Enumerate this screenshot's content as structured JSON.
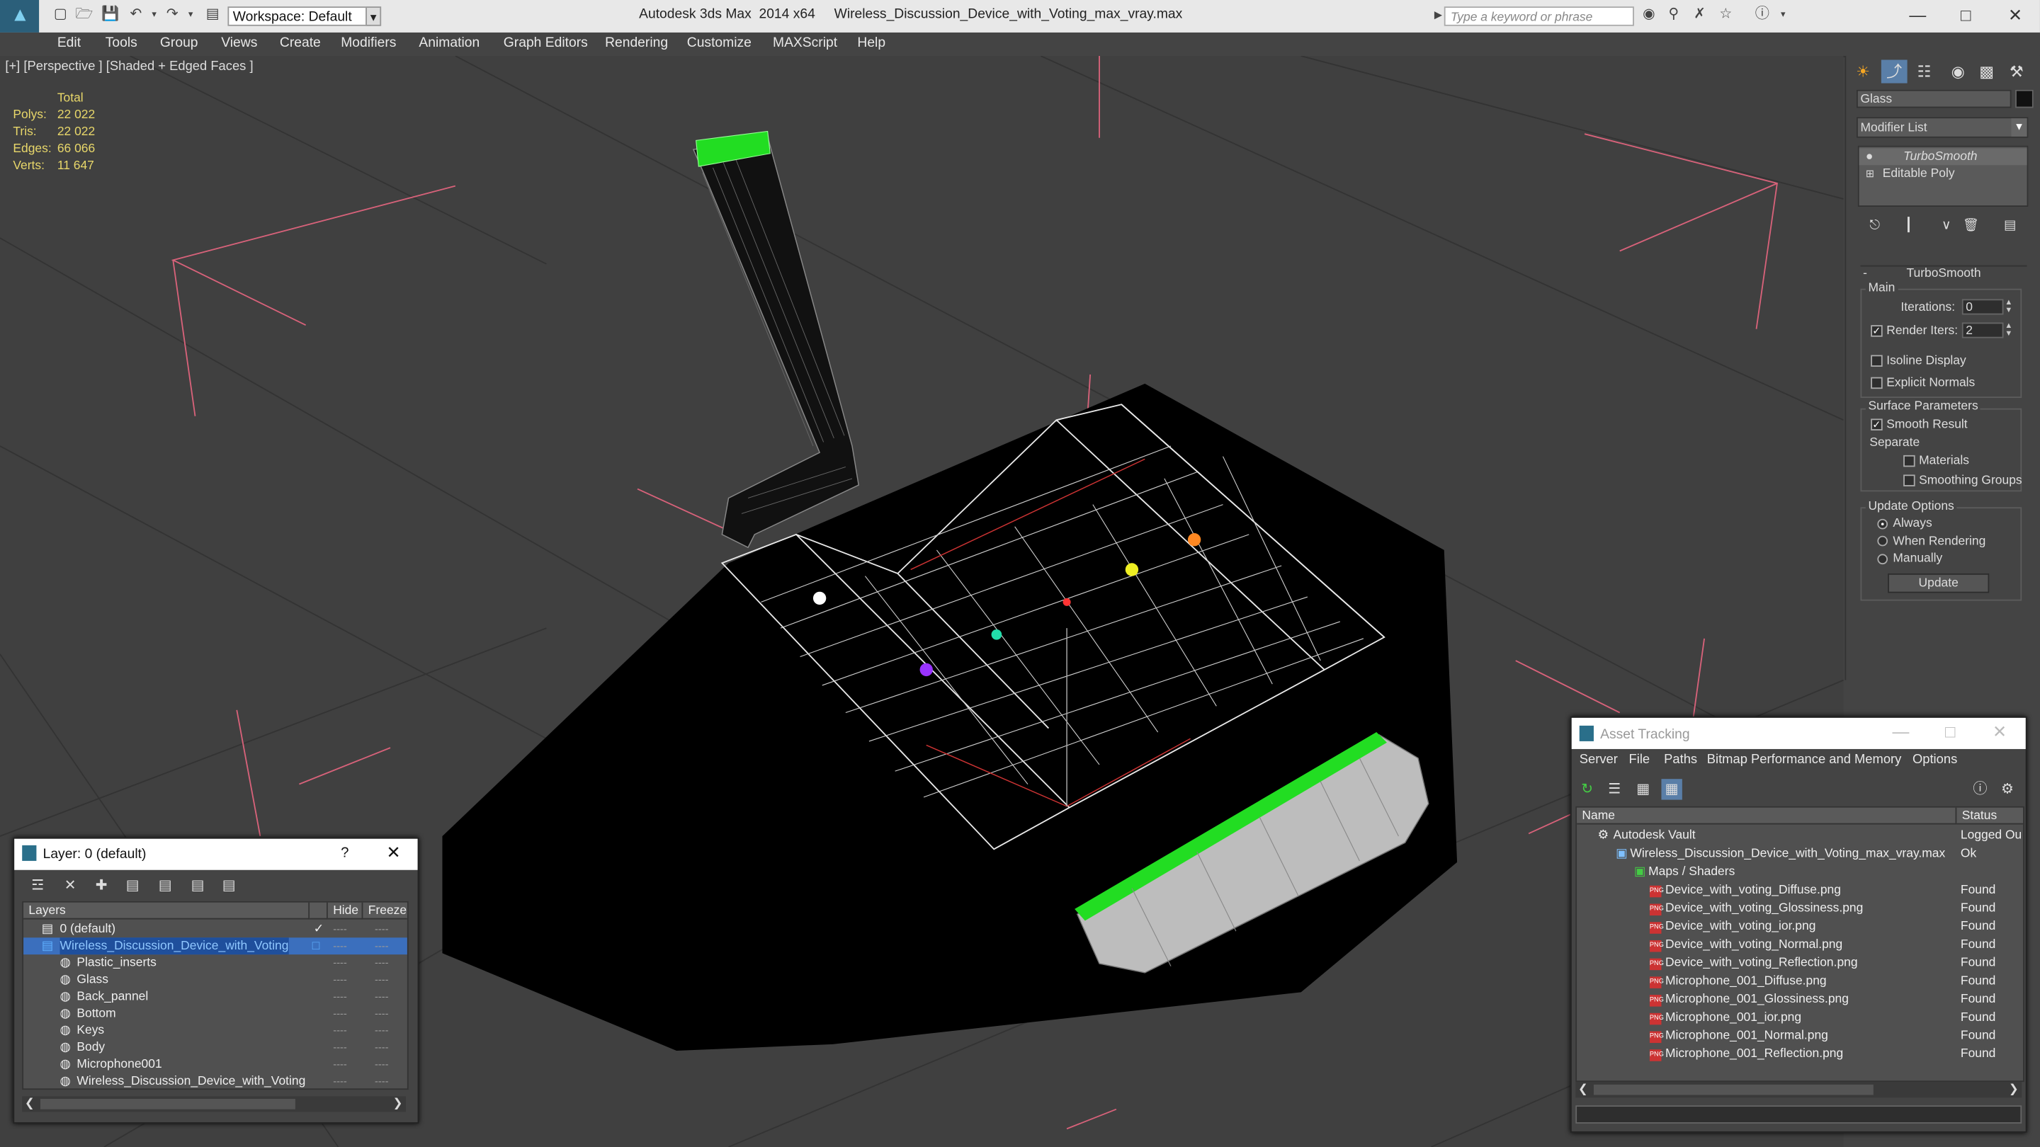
{
  "title_bar": {
    "workspace": "Workspace: Default",
    "app_title": "Autodesk 3ds Max  2014 x64",
    "file_name": "Wireless_Discussion_Device_with_Voting_max_vray.max",
    "search_placeholder": "Type a keyword or phrase"
  },
  "menu": [
    "Edit",
    "Tools",
    "Group",
    "Views",
    "Create",
    "Modifiers",
    "Animation",
    "Graph Editors",
    "Rendering",
    "Customize",
    "MAXScript",
    "Help"
  ],
  "viewport": {
    "label": "[+] [Perspective ] [Shaded + Edged Faces ]",
    "stats": {
      "total_label": "Total",
      "rows": [
        {
          "label": "Polys:",
          "value": "22 022"
        },
        {
          "label": "Tris:",
          "value": "22 022"
        },
        {
          "label": "Edges:",
          "value": "66 066"
        },
        {
          "label": "Verts:",
          "value": "11 647"
        }
      ]
    }
  },
  "command_panel": {
    "object_name": "Glass",
    "modifier_list": "Modifier List",
    "stack": [
      "TurboSmooth",
      "Editable Poly"
    ],
    "rollout_title": "TurboSmooth",
    "main_label": "Main",
    "iterations_label": "Iterations:",
    "iterations_value": "0",
    "render_iters_label": "Render Iters:",
    "render_iters_value": "2",
    "isoline_display": "Isoline Display",
    "explicit_normals": "Explicit Normals",
    "surface_params": "Surface Parameters",
    "smooth_result": "Smooth Result",
    "separate": "Separate",
    "materials": "Materials",
    "smoothing_groups": "Smoothing Groups",
    "update_options": "Update Options",
    "always": "Always",
    "when_rendering": "When Rendering",
    "manually": "Manually",
    "update_button": "Update"
  },
  "layer_dialog": {
    "title": "Layer: 0 (default)",
    "help": "?",
    "col_layers": "Layers",
    "col_hide": "Hide",
    "col_freeze": "Freeze",
    "dash": "----",
    "layers": [
      {
        "name": "0 (default)"
      },
      {
        "name": "Wireless_Discussion_Device_with_Voting"
      },
      {
        "name": "Plastic_inserts"
      },
      {
        "name": "Glass"
      },
      {
        "name": "Back_pannel"
      },
      {
        "name": "Bottom"
      },
      {
        "name": "Keys"
      },
      {
        "name": "Body"
      },
      {
        "name": "Microphone001"
      },
      {
        "name": "Wireless_Discussion_Device_with_Voting"
      }
    ]
  },
  "asset_tracking": {
    "title": "Asset Tracking",
    "menu": [
      "Server",
      "File",
      "Paths",
      "Bitmap Performance and Memory",
      "Options"
    ],
    "col_name": "Name",
    "col_status": "Status",
    "rows": [
      {
        "name": "Autodesk Vault",
        "status": "Logged Ou"
      },
      {
        "name": "Wireless_Discussion_Device_with_Voting_max_vray.max",
        "status": "Ok"
      },
      {
        "name": "Maps / Shaders",
        "status": ""
      },
      {
        "name": "Device_with_voting_Diffuse.png",
        "status": "Found"
      },
      {
        "name": "Device_with_voting_Glossiness.png",
        "status": "Found"
      },
      {
        "name": "Device_with_voting_ior.png",
        "status": "Found"
      },
      {
        "name": "Device_with_voting_Normal.png",
        "status": "Found"
      },
      {
        "name": "Device_with_voting_Reflection.png",
        "status": "Found"
      },
      {
        "name": "Microphone_001_Diffuse.png",
        "status": "Found"
      },
      {
        "name": "Microphone_001_Glossiness.png",
        "status": "Found"
      },
      {
        "name": "Microphone_001_ior.png",
        "status": "Found"
      },
      {
        "name": "Microphone_001_Normal.png",
        "status": "Found"
      },
      {
        "name": "Microphone_001_Reflection.png",
        "status": "Found"
      }
    ]
  },
  "colors": {
    "stats_text": "#e8d76a",
    "selection_blue": "#3b6fbd",
    "accent_green": "#22dd22"
  }
}
